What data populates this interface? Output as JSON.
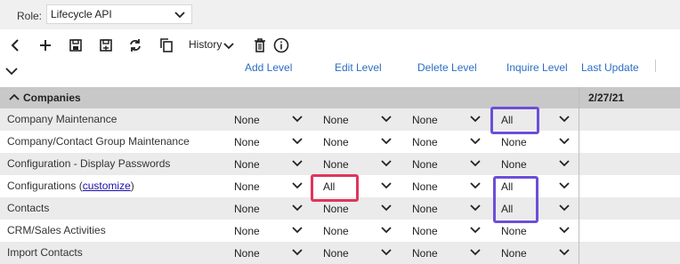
{
  "role": {
    "label": "Role:",
    "value": "Lifecycle API",
    "chevron_icon": "chevron-down-icon"
  },
  "toolbar": {
    "icons": [
      "back-arrow-icon",
      "add-icon",
      "save-icon",
      "save-as-icon",
      "refresh-icon",
      "copy-icon",
      "delete-icon",
      "info-icon"
    ],
    "history_label": "History"
  },
  "columns": {
    "add": "Add Level",
    "edit": "Edit Level",
    "delete": "Delete Level",
    "inquire": "Inquire Level",
    "last_update": "Last Update"
  },
  "section": {
    "title": "Companies",
    "last_update": "2/27/21"
  },
  "rows": [
    {
      "label": "Company Maintenance",
      "link": "",
      "add": "None",
      "edit": "None",
      "delete": "None",
      "inquire": "All"
    },
    {
      "label": "Company/Contact Group Maintenance",
      "link": "",
      "add": "None",
      "edit": "None",
      "delete": "None",
      "inquire": "None"
    },
    {
      "label": "Configuration - Display Passwords",
      "link": "",
      "add": "None",
      "edit": "None",
      "delete": "None",
      "inquire": "None"
    },
    {
      "label": "Configurations (",
      "link": "customize",
      "suffix": ")",
      "add": "None",
      "edit": "All",
      "delete": "None",
      "inquire": "All"
    },
    {
      "label": "Contacts",
      "link": "",
      "add": "None",
      "edit": "None",
      "delete": "None",
      "inquire": "All"
    },
    {
      "label": "CRM/Sales Activities",
      "link": "",
      "add": "None",
      "edit": "None",
      "delete": "None",
      "inquire": "None"
    },
    {
      "label": "Import Contacts",
      "link": "",
      "add": "None",
      "edit": "None",
      "delete": "None",
      "inquire": "None"
    }
  ],
  "colors": {
    "accent_link": "#2a6ec3",
    "highlight_purple": "#6b4fd8",
    "highlight_red": "#e0345c"
  }
}
